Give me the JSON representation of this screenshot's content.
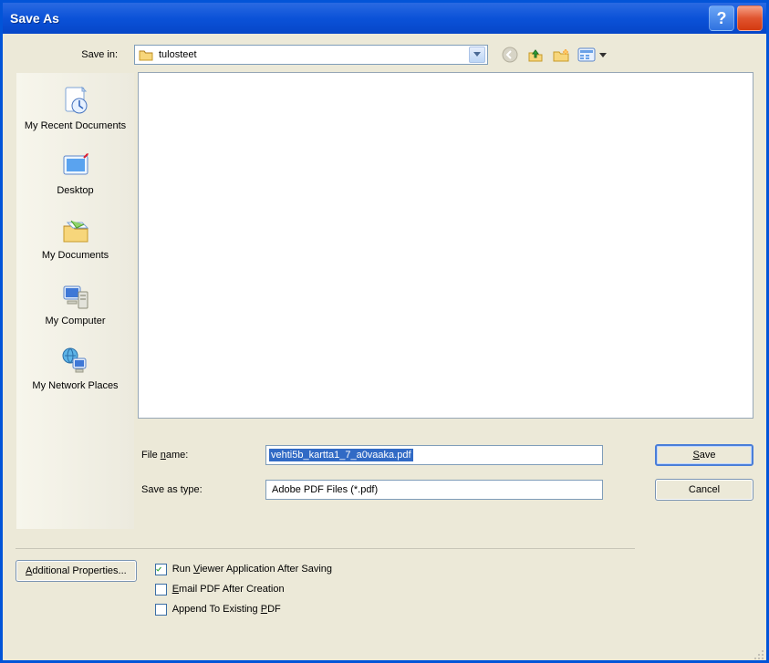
{
  "title": "Save As",
  "saveIn": {
    "label": "Save in:",
    "value": "tulosteet"
  },
  "shortcuts": [
    {
      "label": "My Recent Documents"
    },
    {
      "label": "Desktop"
    },
    {
      "label": "My Documents"
    },
    {
      "label": "My Computer"
    },
    {
      "label": "My Network Places"
    }
  ],
  "fileName": {
    "label": "File name:",
    "value": "vehti5b_kartta1_7_a0vaaka.pdf"
  },
  "saveAsType": {
    "label": "Save as type:",
    "value": "Adobe PDF Files (*.pdf)"
  },
  "buttons": {
    "save": "Save",
    "cancel": "Cancel",
    "additional": "Additional Properties..."
  },
  "checks": {
    "runViewer": "Run Viewer Application After Saving",
    "emailPdf": "Email PDF After Creation",
    "appendPdf": "Append To Existing PDF"
  },
  "checkStates": {
    "runViewer": true,
    "emailPdf": false,
    "appendPdf": false
  }
}
